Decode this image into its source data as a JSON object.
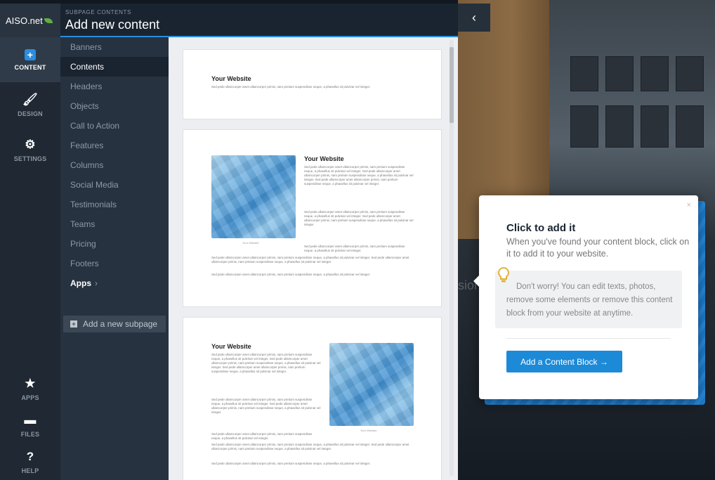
{
  "sidebar": {
    "logo": "AISO.net",
    "content_label": "CONTENT",
    "design_label": "DESIGN",
    "settings_label": "SETTINGS",
    "apps_label": "APPS",
    "files_label": "FILES",
    "help_label": "HELP"
  },
  "header": {
    "subtitle": "SUBPAGE CONTENTS",
    "title": "Add new content"
  },
  "categories": [
    "Banners",
    "Contents",
    "Headers",
    "Objects",
    "Call to Action",
    "Features",
    "Columns",
    "Social Media",
    "Testimonials",
    "Teams",
    "Pricing",
    "Footers"
  ],
  "apps_label": "Apps",
  "apps_chevron": "›",
  "add_subpage": "Add a new subpage",
  "preview": {
    "heading": "Your Website",
    "short_text": "Sed pede ullamcorper amet ullamcorper primis, nam pretium suspendisse neque, a phasellus sit pulvinar vel integer.",
    "body_text": "Sed pede ullamcorper amet ullamcorper primis, nam pretium suspendisse neque, a phasellus sit pulvinar vel integer. Sed pede ullamcorper amet ullamcorper primis, nam pretium suspendisse neque, a phasellus sit pulvinar vel integer. Sed pede ullamcorper amet ullamcorper primis, nam pretium suspendisse neque, a phasellus sit pulvinar vel integer.",
    "body_text_2": "Sed pede ullamcorper amet ullamcorper primis, nam pretium suspendisse neque, a phasellus sit pulvinar vel integer. Sed pede ullamcorper amet ullamcorper primis, nam pretium suspendisse neque, a phasellus sit pulvinar vel integer.",
    "wide_text": "Sed pede ullamcorper amet ullamcorper primis, nam pretium suspendisse neque, a phasellus sit pulvinar vel integer. Sed pede ullamcorper amet ullamcorper primis, nam pretium suspendisse neque, a phasellus sit pulvinar vel integer.",
    "wide_text_2": "Sed pede ullamcorper amet ullamcorper primis, nam pretium suspendisse neque, a phasellus sit pulvinar vel integer.",
    "image_caption": "Your Website"
  },
  "background_text": "sion",
  "tooltip": {
    "title": "Click to add it",
    "description": "When you've found your content block, click on it to add it to your website.",
    "note": "Don't worry! You can edit texts, photos, remove some elements or remove this content block from your website at anytime.",
    "button": "Add a Content Block →",
    "close": "×"
  },
  "icons": {
    "collapse": "chevron-left-icon",
    "content": "plus-square-icon",
    "design": "brush-icon",
    "settings": "gears-icon",
    "apps": "star-icon",
    "files": "folder-icon",
    "help": "help-circle-icon",
    "bulb": "lightbulb-icon"
  },
  "colors": {
    "accent": "#2b8de0",
    "sidebar": "#1f2833",
    "panel": "#273240"
  }
}
